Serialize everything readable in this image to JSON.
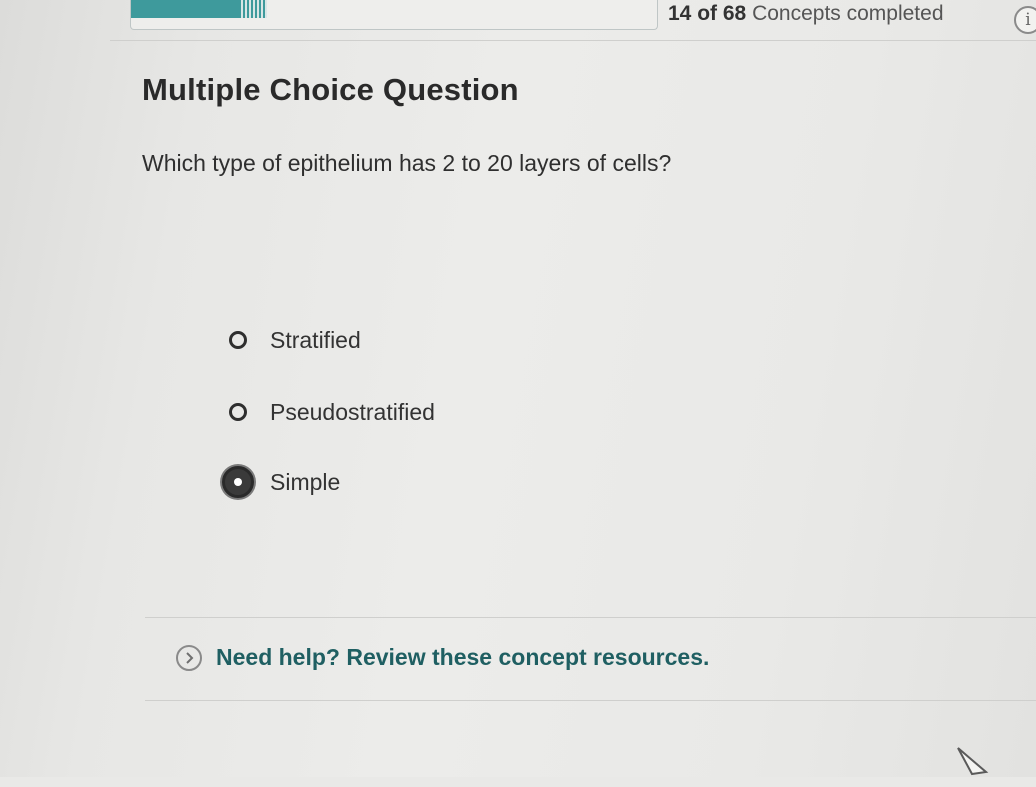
{
  "progress": {
    "completed": "14 of 68",
    "label_suffix": "Concepts completed",
    "fraction": 0.206,
    "accent_color": "#3e9a9c"
  },
  "info_icon": "i",
  "question": {
    "type": "Multiple Choice Question",
    "text": "Which type of epithelium has 2 to 20 layers of cells?"
  },
  "options": [
    {
      "label": "Stratified",
      "selected": false
    },
    {
      "label": "Pseudostratified",
      "selected": false
    },
    {
      "label": "Simple",
      "selected": true
    }
  ],
  "help": {
    "link_text": "Need help? Review these concept resources.",
    "link_color": "#1f5f62"
  },
  "icons": {
    "info": "info-icon",
    "help": "chevron-right-icon",
    "cursor": "mouse-cursor-icon"
  }
}
